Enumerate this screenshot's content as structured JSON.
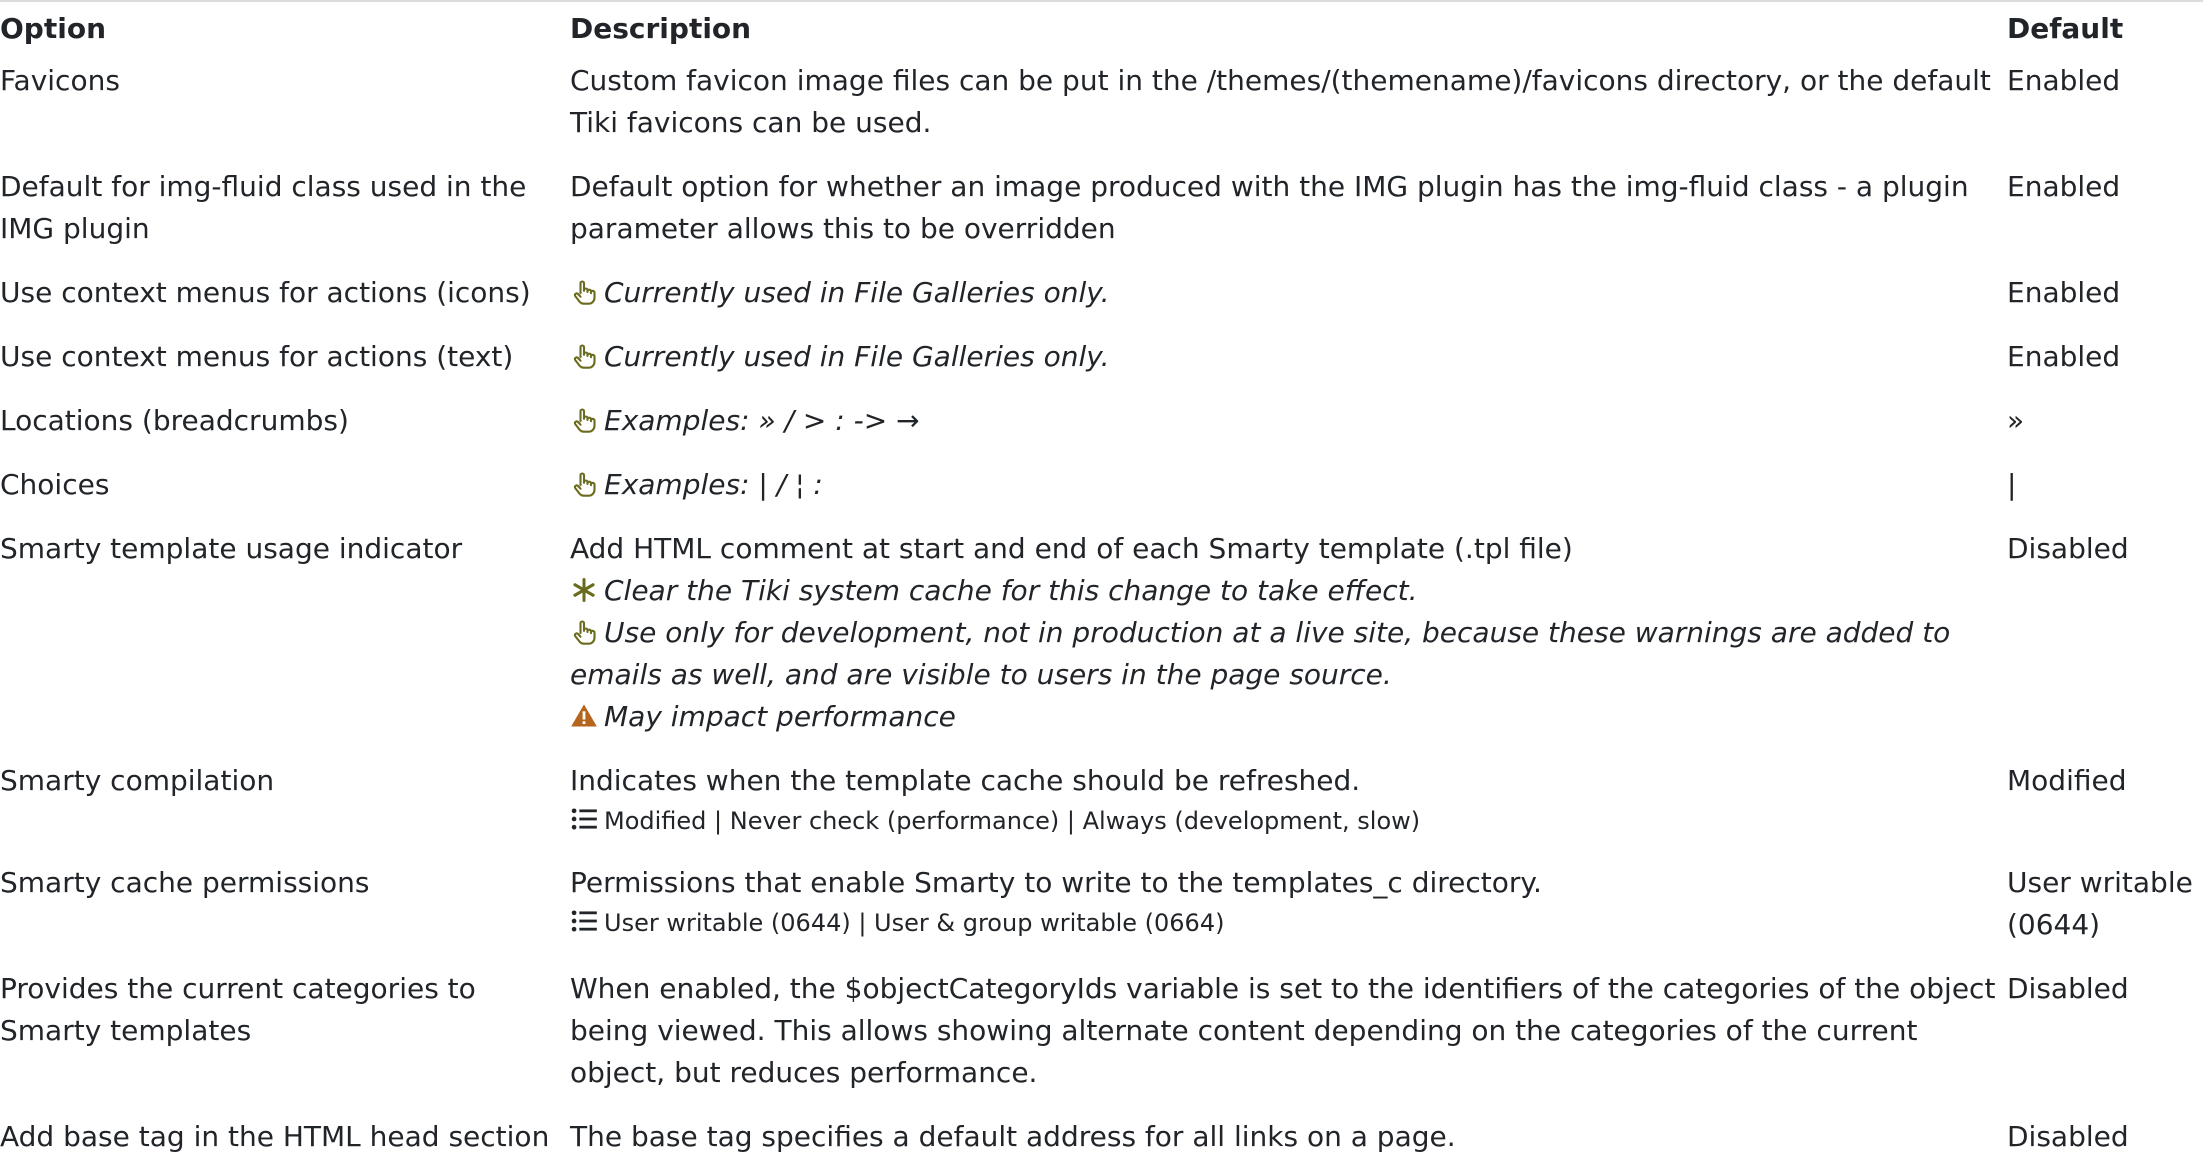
{
  "headers": {
    "option": "Option",
    "description": "Description",
    "default": "Default"
  },
  "rows": [
    {
      "option": "Favicons",
      "description": "Custom favicon image files can be put in the /themes/(themename)/favicons directory, or the default Tiki favicons can be used.",
      "default": "Enabled"
    },
    {
      "option": "Default for img-fluid class used in the IMG plugin",
      "description": "Default option for whether an image produced with the IMG plugin has the img-fluid class - a plugin parameter allows this to be overridden",
      "default": "Enabled"
    },
    {
      "option": "Use context menus for actions (icons)",
      "tip": "Currently used in File Galleries only.",
      "default": "Enabled"
    },
    {
      "option": "Use context menus for actions (text)",
      "tip": "Currently used in File Galleries only.",
      "default": "Enabled"
    },
    {
      "option": "Locations (breadcrumbs)",
      "tip": "Examples: » / > : -> →",
      "default": "»"
    },
    {
      "option": "Choices",
      "tip": "Examples: | / ¦ :",
      "default": "|"
    },
    {
      "option": "Smarty template usage indicator",
      "description": "Add HTML comment at start and end of each Smarty template (.tpl file)",
      "cache_note": "Clear the Tiki system cache for this change to take effect.",
      "tip": "Use only for development, not in production at a live site, because these warnings are added to emails as well, and are visible to users in the page source.",
      "warning": "May impact performance",
      "default": "Disabled"
    },
    {
      "option": "Smarty compilation",
      "description": "Indicates when the template cache should be refreshed.",
      "options": "Modified | Never check (performance) | Always (development, slow)",
      "default": "Modified"
    },
    {
      "option": "Smarty cache permissions",
      "description": "Permissions that enable Smarty to write to the templates_c directory.",
      "options": "User writable (0644) | User & group writable (0664)",
      "default": "User writable (0644)"
    },
    {
      "option": "Provides the current categories to Smarty templates",
      "description": "When enabled, the $objectCategoryIds variable is set to the identifiers of the categories of the object being viewed. This allows showing alternate content depending on the categories of the current object, but reduces performance.",
      "default": "Disabled"
    },
    {
      "option": "Add base tag in the HTML head section",
      "description": "The base tag specifies a default address for all links on a page.",
      "default": "Disabled"
    }
  ],
  "icons": {
    "tip": "hand-pointer-icon",
    "cache": "asterisk-icon",
    "warning": "warning-icon",
    "options": "list-icon"
  },
  "colors": {
    "tip_icon": "#6b6b1f",
    "warning_icon": "#b5651d"
  }
}
